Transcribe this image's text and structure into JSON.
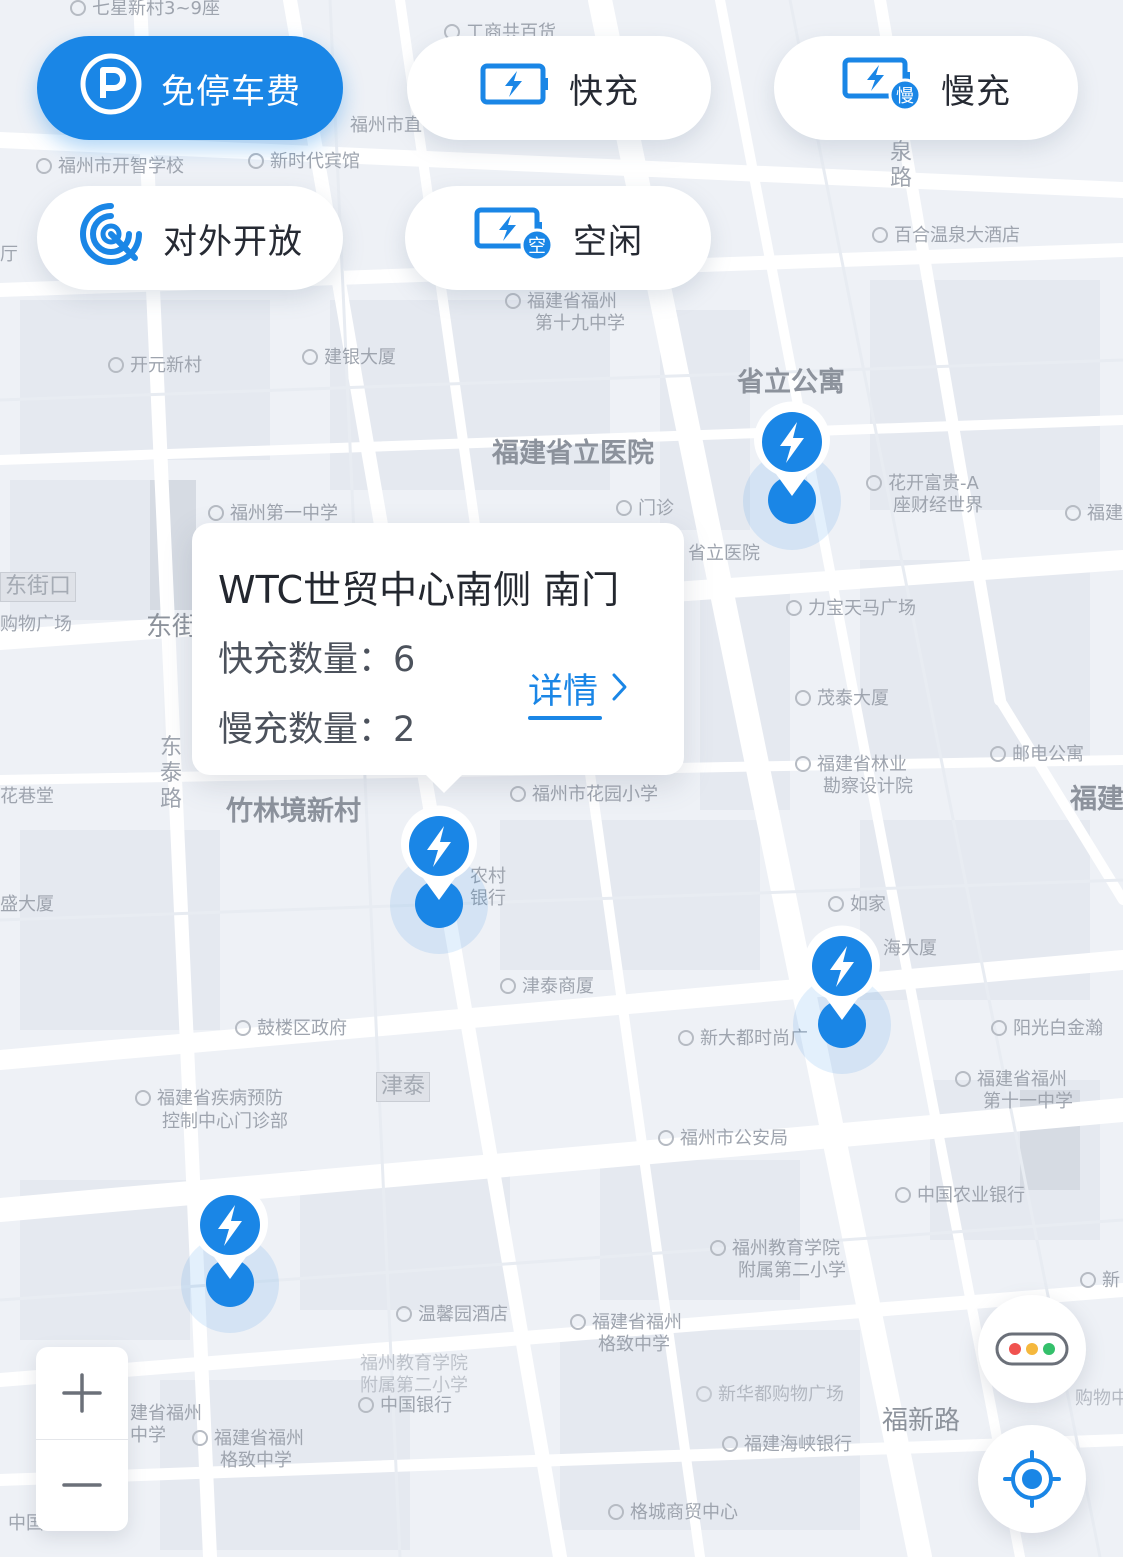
{
  "filters": [
    {
      "label": "免停车费",
      "icon": "parking-icon",
      "active": true
    },
    {
      "label": "快充",
      "icon": "fast-charge-icon",
      "active": false
    },
    {
      "label": "慢充",
      "icon": "slow-charge-icon",
      "badge": "慢",
      "active": false
    },
    {
      "label": "对外开放",
      "icon": "open-signal-icon",
      "active": false
    },
    {
      "label": "空闲",
      "icon": "idle-charge-icon",
      "badge": "空",
      "active": false
    }
  ],
  "popup": {
    "station_name": "WTC世贸中心南侧 南门",
    "fast_label": "快充数量：",
    "fast_count": "6",
    "slow_label": "慢充数量：",
    "slow_count": "2",
    "detail_label": "详情"
  },
  "map_labels": {
    "qixing": "七星新村3~9座",
    "gongmao": "工商共百货",
    "fuzhoushi": "福州市直",
    "kaizhi": "福州市开智学校",
    "xinshidai": "新时代宾馆",
    "baihe": "百合温泉大酒店",
    "quanlu": "泉路",
    "shijiu1": "福建省福州",
    "shijiu2": "第十九中学",
    "kaiyuan": "开元新村",
    "jianyin": "建银大厦",
    "shengligongyu": "省立公寓",
    "shengliyiyuan": "福建省立医院",
    "menzhen": "门诊",
    "huakai1": "花开富贵-A",
    "huakai2": "座财经世界",
    "diyizhong": "福州第一中学",
    "dongjiekou": "东街口",
    "gouwu": "购物广场",
    "dongjie": "东街",
    "shengliyiyuan2": "省立医院",
    "libao": "力宝天马广场",
    "maotai": "茂泰大厦",
    "linye1": "福建省林业",
    "linye2": "勘察设计院",
    "youdian": "邮电公寓",
    "fujian_r": "福建",
    "huaxiang": "花巷堂",
    "dongtailu": "东泰路",
    "zhulin": "竹林境新村",
    "huayuan": "福州市花园小学",
    "nongcun1": "农村",
    "nongcun2": "银行",
    "shengda": "盛大厦",
    "rujia": "如家",
    "haidasha": "海大厦",
    "jintai": "津泰商厦",
    "gulou": "鼓楼区政府",
    "xindadu": "新大都时尚广",
    "yangguang": "阳光白金瀚",
    "jinTai": "津泰",
    "jibing1": "福建省疾病预防",
    "jibing2": "控制中心门诊部",
    "shiyi1": "福建省福州",
    "shiyi2": "第十一中学",
    "gongan": "福州市公安局",
    "nongye": "中国农业银行",
    "jiaoyu1": "福州教育学院",
    "jiaoyu2": "附属第二小学",
    "wenxin": "温馨园酒店",
    "gezhi1": "福建省福州",
    "gezhi2": "格致中学",
    "zhongguo": "中国银行",
    "xinhuadu": "新华都购物广场",
    "fuxinlu": "福新路",
    "haixia": "福建海峡银行",
    "gecheng": "格城商贸中心",
    "gezhi3": "福建省福州",
    "gezhi4": "格致中学",
    "jianfuzhou": "建省福州",
    "zhongxue": "中学",
    "jiaoyu3": "福州教育学院",
    "jiaoyu4": "附属第二小学",
    "zhong_l": "中国",
    "xin_r": "新",
    "huo_r": "购物中",
    "fujian_r2": "福建",
    "ting": "厅"
  },
  "colors": {
    "accent": "#1a86e6",
    "map_bg": "#eef1f6",
    "road": "#ffffff",
    "block": "#e4e8ef",
    "traffic_red": "#f0524f",
    "traffic_yellow": "#f5b83d",
    "traffic_green": "#34c06b"
  },
  "controls": {
    "zoom_in_icon": "plus-icon",
    "zoom_out_icon": "minus-icon",
    "traffic_icon": "traffic-light-icon",
    "locate_icon": "locate-icon"
  }
}
